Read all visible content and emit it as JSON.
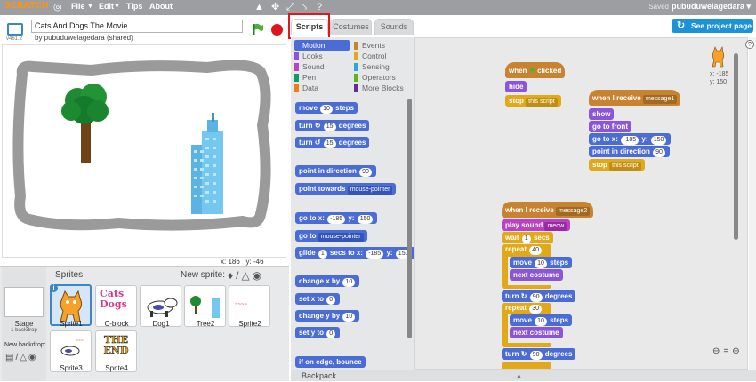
{
  "menubar": {
    "logo": "SCRATCH",
    "file": "File",
    "edit": "Edit",
    "tips": "Tips",
    "about": "About",
    "saved": "Saved",
    "user": "pubuduwelagedara"
  },
  "project": {
    "title": "Cats And Dogs The Movie",
    "byline": "by pubuduwelagedara (shared)",
    "version": "v461.2",
    "see_project_page": "See project page"
  },
  "stage": {
    "x_label": "x:",
    "x_value": "186",
    "y_label": "y:",
    "y_value": "-46"
  },
  "sprites": {
    "header": "Sprites",
    "new_sprite": "New sprite:",
    "stage_label": "Stage",
    "stage_backdrops": "1 backdrop",
    "new_backdrop": "New backdrop:",
    "items": [
      {
        "name": "Sprite1"
      },
      {
        "name": "C-block"
      },
      {
        "name": "Dog1"
      },
      {
        "name": "Tree2"
      },
      {
        "name": "Sprite2"
      },
      {
        "name": "Sprite3"
      },
      {
        "name": "Sprite4"
      }
    ],
    "cblock_text": "Cats Dogs",
    "end_text": "THE END"
  },
  "tabs": {
    "scripts": "Scripts",
    "costumes": "Costumes",
    "sounds": "Sounds"
  },
  "categories": {
    "motion": "Motion",
    "looks": "Looks",
    "sound": "Sound",
    "pen": "Pen",
    "data": "Data",
    "events": "Events",
    "control": "Control",
    "sensing": "Sensing",
    "operators": "Operators",
    "more": "More Blocks"
  },
  "palette": {
    "move": "move",
    "move_n": "10",
    "move_steps": "steps",
    "turn_r": "turn",
    "turn_r_n": "15",
    "degrees": "degrees",
    "turn_l": "turn",
    "turn_l_n": "15",
    "point_dir": "point in direction",
    "point_dir_v": "90",
    "point_towards": "point towards",
    "point_towards_v": "mouse-pointer",
    "goto_xy": "go to x:",
    "goto_x": "-185",
    "goto_y_l": "y:",
    "goto_y": "150",
    "goto": "go to",
    "goto_v": "mouse-pointer",
    "glide": "glide",
    "glide_n": "1",
    "glide_secs": "secs to x:",
    "glide_x": "-185",
    "glide_y_l": "y:",
    "glide_y": "150",
    "change_x": "change x by",
    "change_x_v": "10",
    "set_x": "set x to",
    "set_x_v": "0",
    "change_y": "change y by",
    "change_y_v": "10",
    "set_y": "set y to",
    "set_y_v": "0",
    "bounce": "if on edge, bounce"
  },
  "scripts": {
    "s1": {
      "hat": "when",
      "hat2": "clicked",
      "hide": "hide",
      "stop": "stop",
      "stop_v": "this script"
    },
    "s2": {
      "hat": "when I receive",
      "msg": "message1",
      "show": "show",
      "front": "go to front",
      "goto": "go to x:",
      "x": "-185",
      "y_l": "y:",
      "y": "150",
      "point": "point in direction",
      "dir": "90",
      "stop": "stop",
      "stop_v": "this script"
    },
    "s3": {
      "hat": "when I receive",
      "msg": "message2",
      "play": "play sound",
      "sound": "meow",
      "wait": "wait",
      "wait_n": "1",
      "wait_s": "secs",
      "repeat": "repeat",
      "rep_n": "40",
      "move": "move",
      "move_n": "10",
      "steps": "steps",
      "next": "next costume",
      "turn": "turn",
      "turn_n": "90",
      "degrees": "degrees",
      "repeat2": "repeat",
      "rep2_n": "30",
      "move2": "move",
      "move2_n": "10",
      "next2": "next costume",
      "turn2": "turn",
      "turn2_n": "90"
    }
  },
  "sprite_info": {
    "x": "x: -185",
    "y": "y: 150"
  },
  "backpack": "Backpack",
  "colors": {
    "motion": "#4a6cd4",
    "events": "#c88330",
    "looks": "#8a55d7",
    "control": "#e1a91a",
    "sound": "#bb42c3",
    "highlight": "#e0181b"
  }
}
